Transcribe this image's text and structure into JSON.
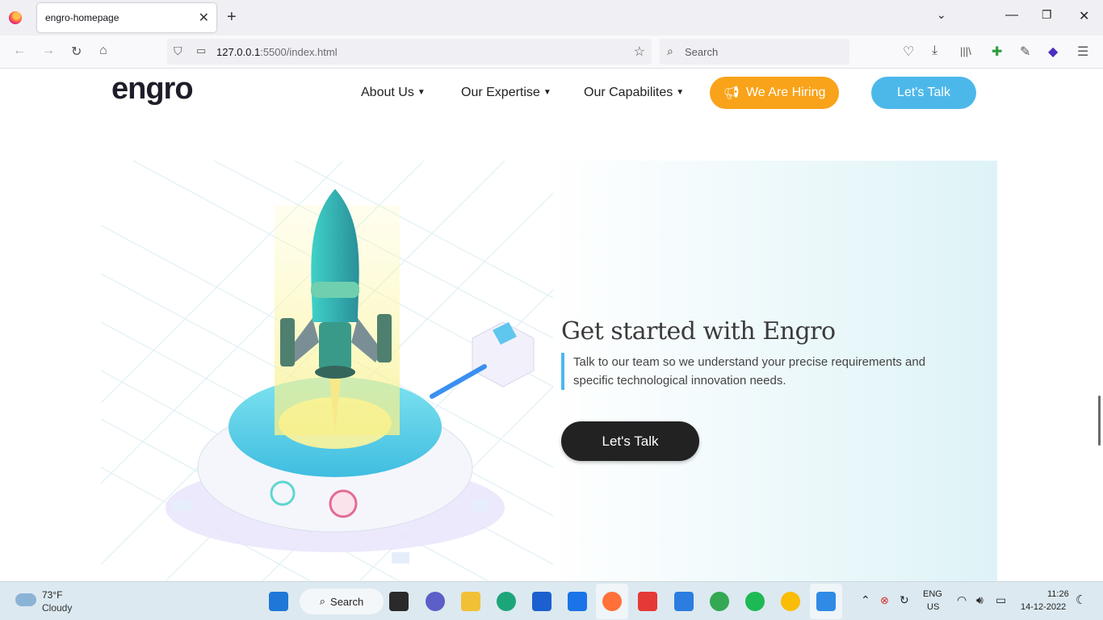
{
  "browser": {
    "tab_title": "engro-homepage",
    "url_host": "127.0.0.1",
    "url_rest": ":5500/index.html",
    "search_placeholder": "Search"
  },
  "site": {
    "logo": "engro",
    "nav": [
      {
        "label": "About Us"
      },
      {
        "label": "Our Expertise"
      },
      {
        "label": "Our Capabilites"
      }
    ],
    "hiring_button": "We Are Hiring",
    "talk_button": "Let's Talk"
  },
  "hero": {
    "title": "Get started with Engro",
    "description": "Talk to our team so we understand your precise requirements and specific technological innovation needs.",
    "cta": "Let's Talk"
  },
  "taskbar": {
    "weather_temp": "73°F",
    "weather_cond": "Cloudy",
    "search_label": "Search",
    "lang_top": "ENG",
    "lang_bottom": "US",
    "time": "11:26",
    "date": "14-12-2022"
  },
  "colors": {
    "hiring": "#f9a31a",
    "talk": "#4cb8ea",
    "cta": "#222222"
  }
}
